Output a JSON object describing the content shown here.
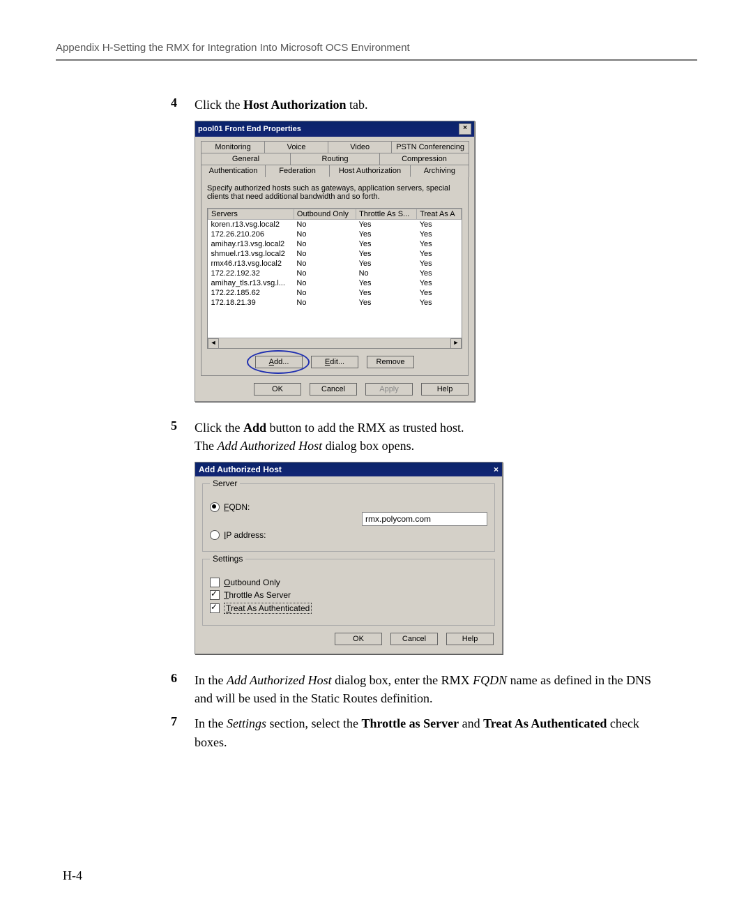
{
  "header": "Appendix H-Setting the RMX for Integration Into Microsoft OCS Environment",
  "page_number": "H-4",
  "steps": {
    "s4": {
      "num": "4",
      "text_pre": "Click the ",
      "bold": "Host Authorization",
      "text_post": " tab."
    },
    "s5": {
      "num": "5",
      "line1_pre": "Click the ",
      "line1_bold": "Add",
      "line1_post": " button to add the RMX as trusted host.",
      "line2_pre": "The ",
      "line2_italic": "Add Authorized Host",
      "line2_post": " dialog box opens."
    },
    "s6": {
      "num": "6",
      "pre": "In the ",
      "i1": "Add Authorized Host",
      "mid1": " dialog box, enter the RMX ",
      "i2": "FQDN",
      "post": " name as defined in the DNS and will be used in the Static Routes definition."
    },
    "s7": {
      "num": "7",
      "pre": "In the ",
      "i1": "Settings",
      "mid1": " section, select the ",
      "b1": "Throttle as Server",
      "mid2": " and ",
      "b2": "Treat As Authenticated",
      "post": " check boxes."
    }
  },
  "dlg1": {
    "title": "pool01 Front End Properties",
    "tabs_row1": [
      "Monitoring",
      "Voice",
      "Video",
      "PSTN Conferencing"
    ],
    "tabs_row2": [
      "General",
      "Routing",
      "Compression"
    ],
    "tabs_row3": [
      "Authentication",
      "Federation",
      "Host Authorization",
      "Archiving"
    ],
    "description": "Specify authorized hosts such as gateways, application servers, special clients that need additional bandwidth and so forth.",
    "cols": [
      "Servers",
      "Outbound Only",
      "Throttle As S...",
      "Treat As A"
    ],
    "rows": [
      {
        "s": "koren.r13.vsg.local2",
        "o": "No",
        "t": "Yes",
        "a": "Yes"
      },
      {
        "s": "172.26.210.206",
        "o": "No",
        "t": "Yes",
        "a": "Yes"
      },
      {
        "s": "amihay.r13.vsg.local2",
        "o": "No",
        "t": "Yes",
        "a": "Yes"
      },
      {
        "s": "shmuel.r13.vsg.local2",
        "o": "No",
        "t": "Yes",
        "a": "Yes"
      },
      {
        "s": "rmx46.r13.vsg.local2",
        "o": "No",
        "t": "Yes",
        "a": "Yes"
      },
      {
        "s": "172.22.192.32",
        "o": "No",
        "t": "No",
        "a": "Yes"
      },
      {
        "s": "amihay_tls.r13.vsg.l...",
        "o": "No",
        "t": "Yes",
        "a": "Yes"
      },
      {
        "s": "172.22.185.62",
        "o": "No",
        "t": "Yes",
        "a": "Yes"
      },
      {
        "s": "172.18.21.39",
        "o": "No",
        "t": "Yes",
        "a": "Yes"
      }
    ],
    "buttons_mid": {
      "add": "Add...",
      "edit": "Edit...",
      "remove": "Remove"
    },
    "buttons_bot": {
      "ok": "OK",
      "cancel": "Cancel",
      "apply": "Apply",
      "help": "Help"
    }
  },
  "dlg2": {
    "title": "Add Authorized Host",
    "group_server": "Server",
    "fqdn_label": "FQDN:",
    "ip_label": "IP address:",
    "fqdn_value": "rmx.polycom.com",
    "group_settings": "Settings",
    "outbound": "Outbound Only",
    "throttle": "Throttle As Server",
    "treat": "Treat As Authenticated",
    "buttons": {
      "ok": "OK",
      "cancel": "Cancel",
      "help": "Help"
    }
  }
}
